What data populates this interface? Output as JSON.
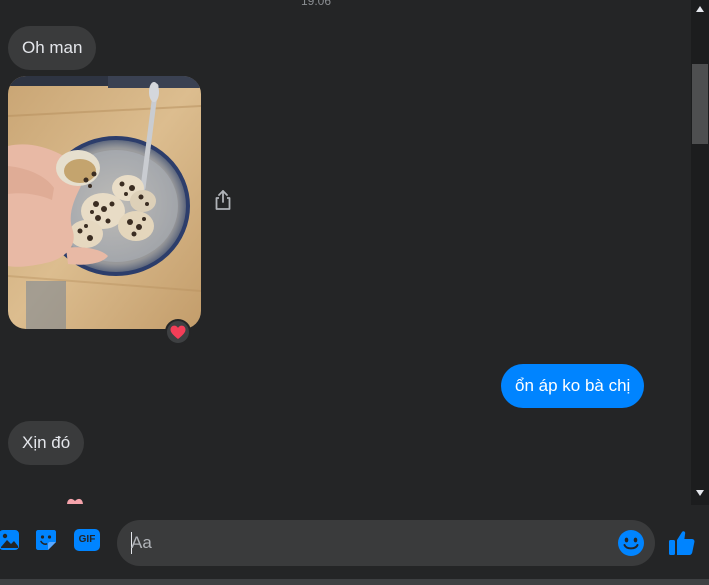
{
  "colors": {
    "background": "#242526",
    "incoming_bubble": "#3a3b3c",
    "outgoing_bubble": "#0084ff",
    "accent": "#0084ff",
    "reaction_heart": "#f33e58"
  },
  "conversation": {
    "timestamp": "19:06",
    "messages": [
      {
        "direction": "incoming",
        "type": "text",
        "text": "Oh man"
      },
      {
        "direction": "incoming",
        "type": "image",
        "image_icon": "photo-snails-in-bowl",
        "reaction": "heart-icon"
      },
      {
        "direction": "outgoing",
        "type": "text",
        "text": "ổn áp ko bà chị"
      },
      {
        "direction": "incoming",
        "type": "text",
        "text": "Xịn đó"
      }
    ],
    "share_icon": "share-icon"
  },
  "composer": {
    "placeholder": "Aa",
    "value": "",
    "tools": [
      "image-icon",
      "sticker-icon",
      "gif-icon"
    ],
    "gif_label": "GIF",
    "emoji_icon": "smile-icon",
    "send_icon": "thumbs-up-icon"
  },
  "scrollbar": {
    "up_icon": "triangle-up-icon",
    "down_icon": "triangle-down-icon"
  }
}
